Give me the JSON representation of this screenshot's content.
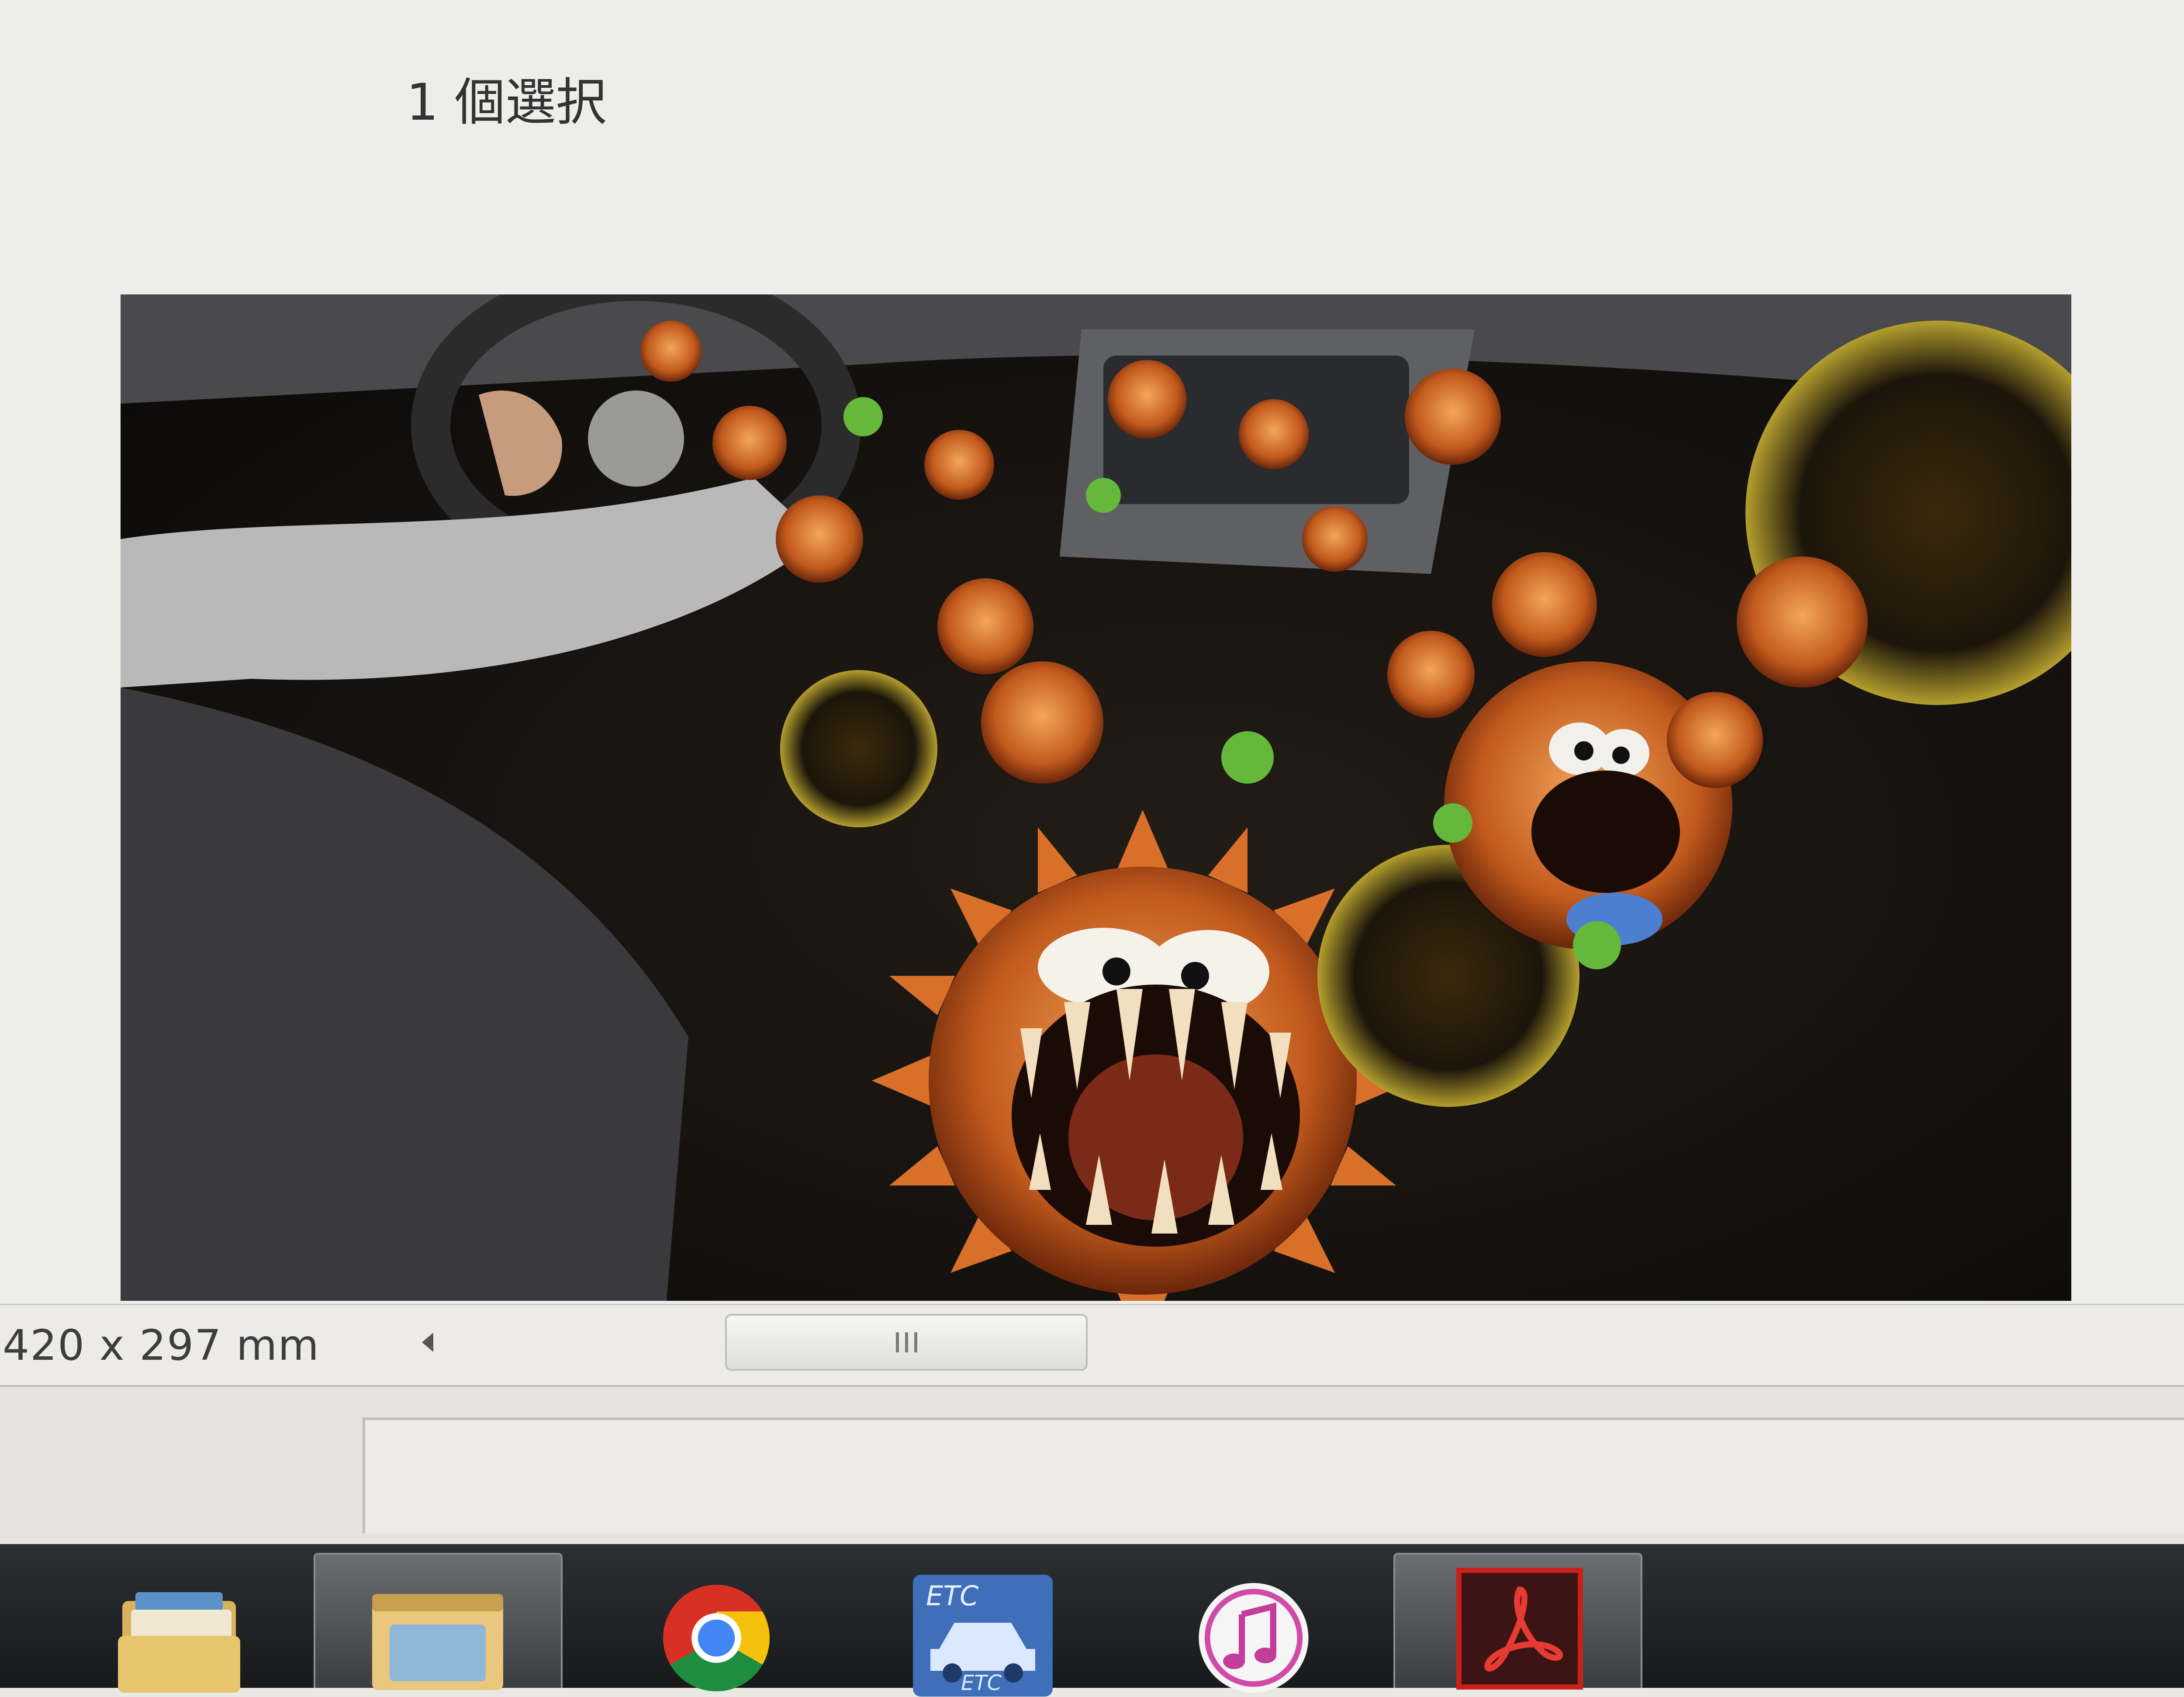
{
  "document": {
    "page_size": "420 x 297 mm"
  },
  "status": {
    "selection_text": "1 個選択"
  },
  "taskbar": {
    "apps": [
      {
        "name": "file-explorer",
        "icon": "folder-icon"
      },
      {
        "name": "open-window",
        "icon": "window-icon"
      },
      {
        "name": "chrome",
        "icon": "chrome-icon"
      },
      {
        "name": "etc-tool",
        "icon": "etc-car-icon",
        "label": "ETC"
      },
      {
        "name": "itunes",
        "icon": "music-note-icon"
      },
      {
        "name": "adobe-reader",
        "icon": "acrobat-icon"
      }
    ]
  },
  "colors": {
    "taskbar": "#1d1f21",
    "acrobat_red": "#c8201c",
    "chrome_red": "#d93025",
    "chrome_yellow": "#f4c20d",
    "chrome_green": "#1e8e3e",
    "chrome_blue": "#4285f4"
  }
}
